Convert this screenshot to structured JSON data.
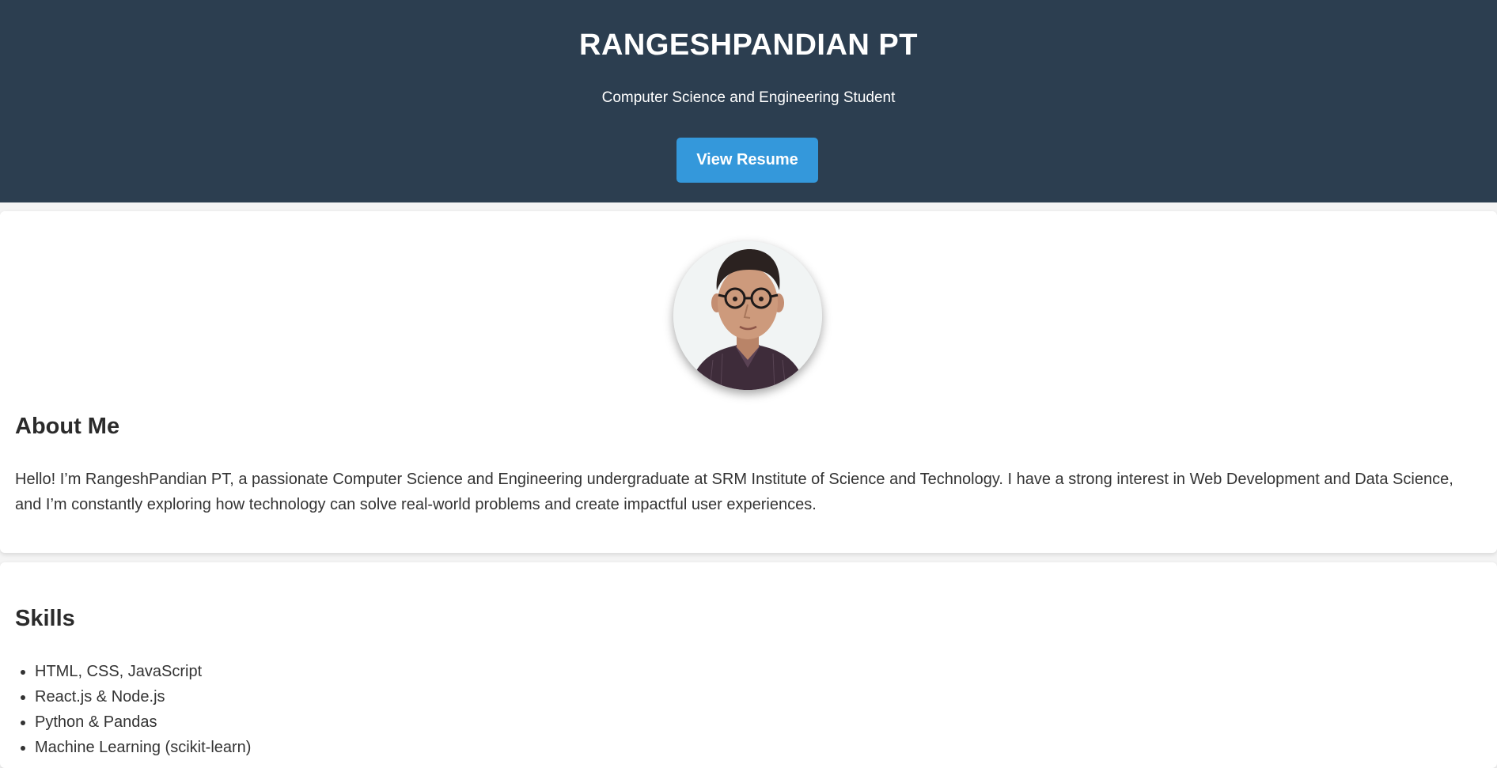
{
  "header": {
    "name": "RANGESHPANDIAN PT",
    "subtitle": "Computer Science and Engineering Student",
    "resume_button_label": "View Resume",
    "background_color": "#2c3e50",
    "button_color": "#3498db"
  },
  "about": {
    "heading": "About Me",
    "text": "Hello! I’m RangeshPandian PT, a passionate Computer Science and Engineering undergraduate at SRM Institute of Science and Technology. I have a strong interest in Web Development and Data Science, and I’m constantly exploring how technology can solve real-world problems and create impactful user experiences.",
    "avatar_icon": "profile-photo"
  },
  "skills": {
    "heading": "Skills",
    "items": [
      "HTML, CSS, JavaScript",
      "React.js & Node.js",
      "Python & Pandas",
      "Machine Learning (scikit-learn)"
    ]
  }
}
